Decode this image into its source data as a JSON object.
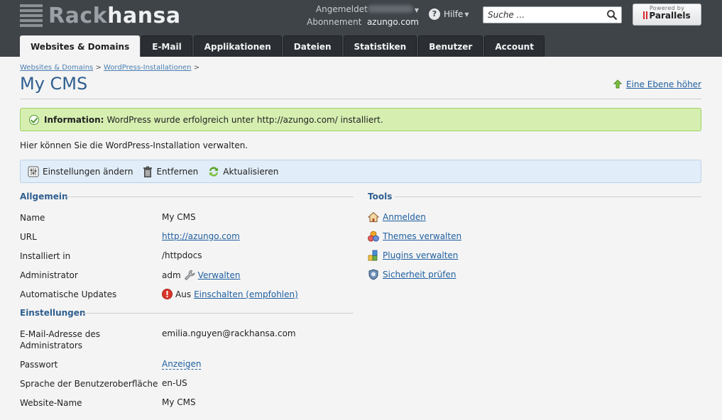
{
  "header": {
    "logo_part1": "Rack",
    "logo_part2": "hansa",
    "logged_in_label": "Angemeldet",
    "subscription_label": "Abonnement",
    "subscription_value": "azungo.com",
    "help_label": "Hilfe",
    "search_placeholder": "Suche ...",
    "powered_by": "Powered by",
    "parallels": "Parallels"
  },
  "tabs": [
    {
      "label": "Websites & Domains",
      "active": true
    },
    {
      "label": "E-Mail"
    },
    {
      "label": "Applikationen"
    },
    {
      "label": "Dateien"
    },
    {
      "label": "Statistiken"
    },
    {
      "label": "Benutzer"
    },
    {
      "label": "Account"
    }
  ],
  "breadcrumb": {
    "item1": "Websites & Domains",
    "sep": ">",
    "item2": "WordPress-Installationen"
  },
  "page_title": "My CMS",
  "up_link": "Eine Ebene höher",
  "info": {
    "label": "Information:",
    "text": "WordPress wurde erfolgreich unter http://azungo.com/ installiert."
  },
  "intro": "Hier können Sie die WordPress-Installation verwalten.",
  "toolbar": {
    "settings": "Einstellungen ändern",
    "remove": "Entfernen",
    "update": "Aktualisieren"
  },
  "general": {
    "heading": "Allgemein",
    "name_label": "Name",
    "name_value": "My CMS",
    "url_label": "URL",
    "url_value": "http://azungo.com",
    "installed_label": "Installiert in",
    "installed_value": "/httpdocs",
    "admin_label": "Administrator",
    "admin_value": "adm",
    "admin_manage": "Verwalten",
    "autoupdate_label": "Automatische Updates",
    "autoupdate_value": "Aus",
    "autoupdate_enable": "Einschalten (empfohlen)"
  },
  "settings": {
    "heading": "Einstellungen",
    "email_label": "E-Mail-Adresse des Administrators",
    "email_value": "emilia.nguyen@rackhansa.com",
    "password_label": "Passwort",
    "password_show": "Anzeigen",
    "language_label": "Sprache der Benutzeroberfläche",
    "language_value": "en-US",
    "sitename_label": "Website-Name",
    "sitename_value": "My CMS"
  },
  "tools": {
    "heading": "Tools",
    "login": "Anmelden",
    "themes": "Themes verwalten",
    "plugins": "Plugins verwalten",
    "security": "Sicherheit prüfen"
  },
  "colors": {
    "header_bg": "#3f4449",
    "accent": "#2f5f8f",
    "link": "#1f5fa0",
    "info_bg": "#d6efb1"
  }
}
